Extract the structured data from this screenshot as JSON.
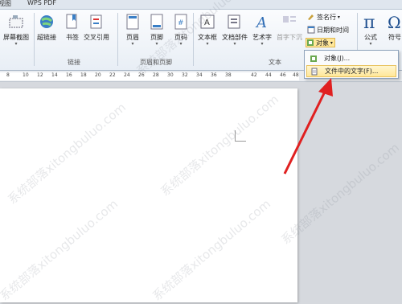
{
  "tabs": {
    "left_partial": "视图",
    "wps_pdf": "WPS PDF"
  },
  "ribbon": {
    "screenshot": "屏幕截图",
    "hyperlink": "超链接",
    "bookmark": "书签",
    "crossref": "交叉引用",
    "header": "页眉",
    "footer": "页脚",
    "page_number": "页码",
    "textbox": "文本框",
    "quickparts": "文档部件",
    "wordart": "艺术字",
    "dropcap": "首字下沉",
    "signature": "签名行",
    "datetime": "日期和时间",
    "object": "对象",
    "formula": "公式",
    "symbol": "符号",
    "group_links": "链接",
    "group_header_footer": "页眉和页脚",
    "group_text": "文本"
  },
  "ruler": {
    "numbers": [
      "8",
      "10",
      "12",
      "14",
      "16",
      "18",
      "20",
      "22",
      "24",
      "26",
      "28",
      "30",
      "32",
      "34",
      "36",
      "38",
      "42",
      "44",
      "46",
      "48"
    ]
  },
  "menu": {
    "item1": "对象(J)...",
    "item2": "文件中的文字(F)..."
  },
  "watermark": "系统部落xitongbuluo.com",
  "colors": {
    "arrow": "#e02020",
    "highlight": "#ffe79a"
  }
}
